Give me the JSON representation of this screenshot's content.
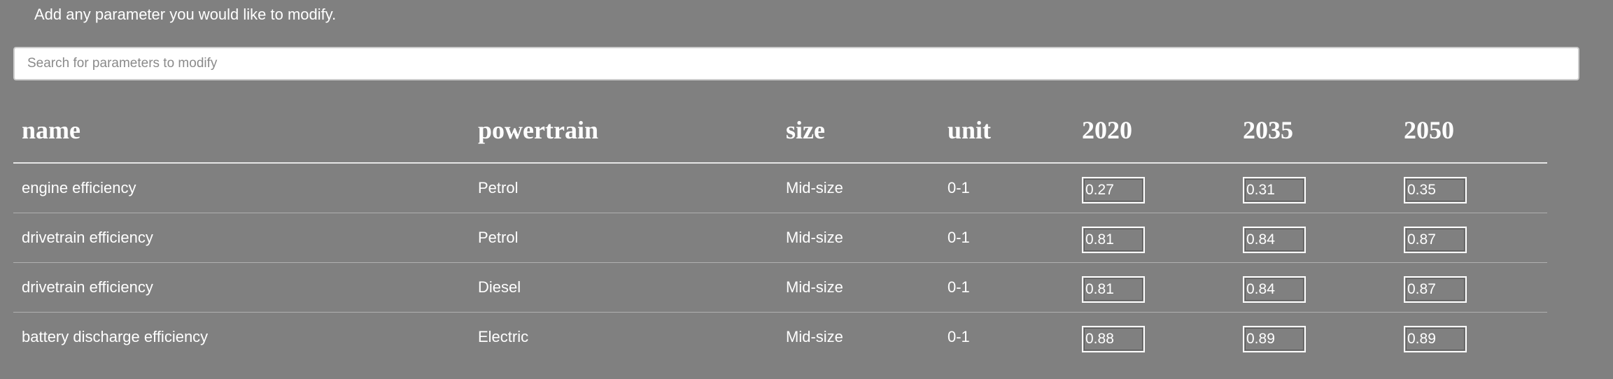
{
  "instruction": "Add any parameter you would like to modify.",
  "search": {
    "placeholder": "Search for parameters to modify",
    "value": ""
  },
  "table": {
    "headers": {
      "name": "name",
      "powertrain": "powertrain",
      "size": "size",
      "unit": "unit",
      "y2020": "2020",
      "y2035": "2035",
      "y2050": "2050"
    },
    "rows": [
      {
        "name": "engine efficiency",
        "powertrain": "Petrol",
        "size": "Mid-size",
        "unit": "0-1",
        "y2020": "0.27",
        "y2035": "0.31",
        "y2050": "0.35"
      },
      {
        "name": "drivetrain efficiency",
        "powertrain": "Petrol",
        "size": "Mid-size",
        "unit": "0-1",
        "y2020": "0.81",
        "y2035": "0.84",
        "y2050": "0.87"
      },
      {
        "name": "drivetrain efficiency",
        "powertrain": "Diesel",
        "size": "Mid-size",
        "unit": "0-1",
        "y2020": "0.81",
        "y2035": "0.84",
        "y2050": "0.87"
      },
      {
        "name": "battery discharge efficiency",
        "powertrain": "Electric",
        "size": "Mid-size",
        "unit": "0-1",
        "y2020": "0.88",
        "y2035": "0.89",
        "y2050": "0.89"
      }
    ]
  }
}
